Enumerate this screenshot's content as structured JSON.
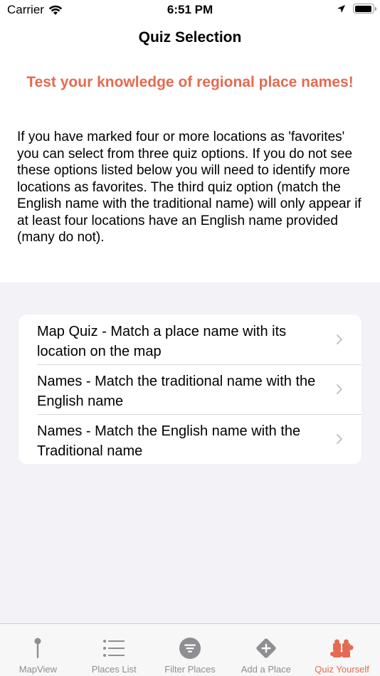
{
  "status_bar": {
    "carrier": "Carrier",
    "time": "6:51 PM",
    "battery_level": 0.92
  },
  "nav": {
    "title": "Quiz Selection"
  },
  "headline": "Test your knowledge of regional place names!",
  "description": "If you have marked four or more locations as 'favorites' you can select from three quiz options. If you do not see these options listed below you will need to identify more locations as favorites. The third quiz option (match the English name with the traditional name) will only appear if at least four locations have an English name provided (many do not).",
  "quiz_options": [
    {
      "label": "Map Quiz - Match a place name with its location on the map"
    },
    {
      "label": "Names - Match the traditional name with the English name"
    },
    {
      "label": "Names - Match the English name with the Traditional name"
    }
  ],
  "tabs": [
    {
      "label": "MapView",
      "icon": "map-pin-icon",
      "active": false
    },
    {
      "label": "Places List",
      "icon": "list-icon",
      "active": false
    },
    {
      "label": "Filter Places",
      "icon": "filter-icon",
      "active": false
    },
    {
      "label": "Add a Place",
      "icon": "add-diamond-icon",
      "active": false
    },
    {
      "label": "Quiz Yourself",
      "icon": "puzzle-icon",
      "active": true
    }
  ],
  "colors": {
    "accent": "#e56a50",
    "inactive_tab": "#8e8e93",
    "grouped_background": "#f2f2f7"
  }
}
